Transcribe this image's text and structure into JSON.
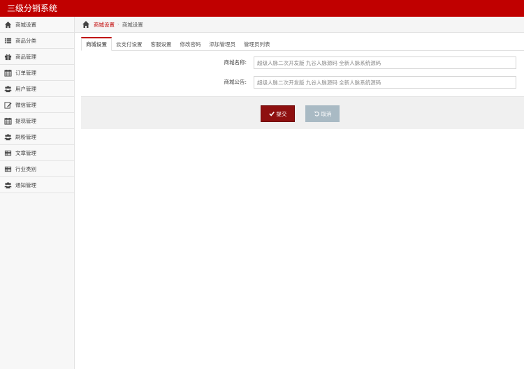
{
  "app": {
    "title": "三级分销系统"
  },
  "sidebar": {
    "items": [
      {
        "label": "商城设置",
        "icon": "home-icon"
      },
      {
        "label": "商品分类",
        "icon": "list-icon"
      },
      {
        "label": "商品管理",
        "icon": "gift-icon"
      },
      {
        "label": "订单管理",
        "icon": "calendar-icon"
      },
      {
        "label": "用户管理",
        "icon": "users-icon"
      },
      {
        "label": "微信管理",
        "icon": "edit-icon"
      },
      {
        "label": "提现管理",
        "icon": "calendar-icon"
      },
      {
        "label": "刷粉管理",
        "icon": "users-icon"
      },
      {
        "label": "文章管理",
        "icon": "list-alt-icon"
      },
      {
        "label": "行业类别",
        "icon": "list-alt-icon"
      },
      {
        "label": "通知管理",
        "icon": "users-icon"
      }
    ]
  },
  "breadcrumb": {
    "link": "商城设置",
    "separator": "›",
    "current": "商城设置"
  },
  "tabs": [
    {
      "label": "商城设置",
      "active": true
    },
    {
      "label": "云支付设置",
      "active": false
    },
    {
      "label": "客服设置",
      "active": false
    },
    {
      "label": "修改密码",
      "active": false
    },
    {
      "label": "添加管理员",
      "active": false
    },
    {
      "label": "管理员列表",
      "active": false
    }
  ],
  "form": {
    "shop_name": {
      "label": "商城名称:",
      "value": "超级人脉二次开发版 九谷人脉源码 全新人脉系统源码"
    },
    "shop_notice": {
      "label": "商城公告:",
      "value": "超级人脉二次开发版 九谷人脉源码 全新人脉系统源码"
    }
  },
  "actions": {
    "submit_label": "提交",
    "cancel_label": "取消"
  },
  "colors": {
    "brand": "#c00000",
    "submit": "#8e1010",
    "cancel": "#a9bac4"
  }
}
